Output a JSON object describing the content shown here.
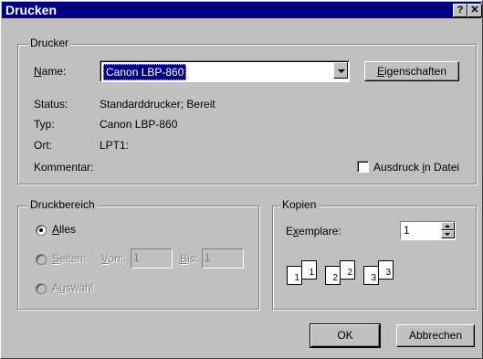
{
  "window": {
    "title": "Drucken",
    "help_glyph": "?",
    "close_glyph": "✕"
  },
  "printer": {
    "group_label": "Drucker",
    "name_label": "Name:",
    "name_value": "Canon LBP-860",
    "properties_button": "Eigenschaften",
    "status_label": "Status:",
    "status_value": "Standarddrucker; Bereit",
    "type_label": "Typ:",
    "type_value": "Canon LBP-860",
    "location_label": "Ort:",
    "location_value": "LPT1:",
    "comment_label": "Kommentar:",
    "print_to_file_label": "Ausdruck in Datei",
    "print_to_file_checked": false
  },
  "range": {
    "group_label": "Druckbereich",
    "all_label": "Alles",
    "pages_label": "Seiten:",
    "from_label": "Von:",
    "from_value": "1",
    "to_label": "Bis:",
    "to_value": "1",
    "selection_label": "Auswahl",
    "selected": "Alles"
  },
  "copies": {
    "group_label": "Kopien",
    "copies_label": "Exemplare:",
    "copies_value": "1",
    "collate_pages": [
      "1",
      "1",
      "2",
      "2",
      "3",
      "3"
    ]
  },
  "buttons": {
    "ok": "OK",
    "cancel": "Abbrechen"
  }
}
